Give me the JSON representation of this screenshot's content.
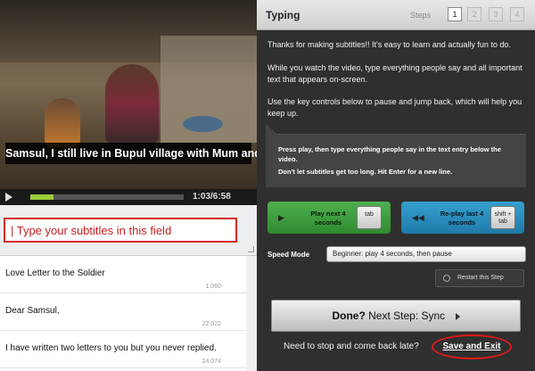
{
  "video": {
    "caption": "Samsul, I still live in Bupul village with Mum and Dad.",
    "time": "1:03/6:58",
    "progress": 0.15
  },
  "entry": {
    "placeholder": "| Type your subtitles in this field"
  },
  "subtitles": [
    {
      "text": "Love Letter to the Soldier",
      "time": "1.060"
    },
    {
      "text": "Dear Samsul,",
      "time": "22.022"
    },
    {
      "text": "I have written two letters to you but you never replied.",
      "time": "24.074"
    }
  ],
  "header": {
    "title": "Typing",
    "steps_label": "Steps",
    "steps": [
      "1",
      "2",
      "3",
      "4"
    ],
    "active_step": "1"
  },
  "intro": [
    "Thanks for making subtitles!! It's easy to learn and actually fun to do.",
    "While you watch the video, type everything people say and all important text that appears on-screen.",
    "Use the key controls below to pause and jump back, which will help you keep up."
  ],
  "tip": {
    "line1": "Press play, then type everything people say in the text entry below the video.",
    "line2": "Don't let subtitles get too long. Hit Enter for a new line."
  },
  "actions": {
    "play": {
      "label": "Play next 4 seconds",
      "key": "tab",
      "icon": "play-icon"
    },
    "replay": {
      "label": "Re-play last 4 seconds",
      "key": "shift + tab",
      "icon": "rewind-icon"
    }
  },
  "speed": {
    "label": "Speed Mode",
    "value": "Beginner: play 4 seconds, then pause"
  },
  "restart_label": "Restart this Step",
  "done": {
    "strong": "Done?",
    "rest": "Next Step: Sync"
  },
  "stop_text": "Need to stop and come back late",
  "stop_question": "?",
  "save_exit": "Save and Exit",
  "colors": {
    "green": "#3a9c3a",
    "blue": "#2a8cbc",
    "highlight": "#e01a1a"
  }
}
